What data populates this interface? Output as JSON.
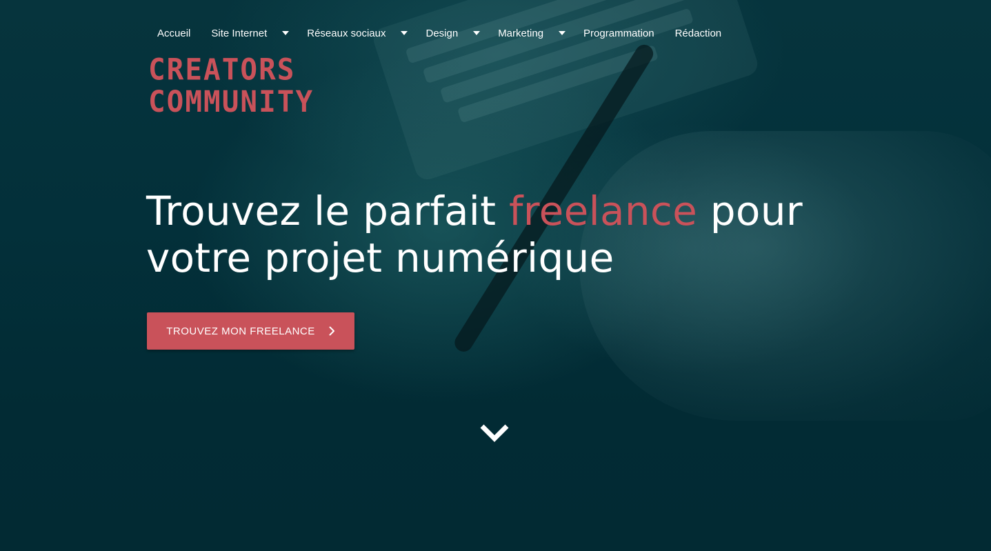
{
  "nav": {
    "items": [
      {
        "label": "Accueil",
        "dropdown": false
      },
      {
        "label": "Site Internet",
        "dropdown": true
      },
      {
        "label": "Réseaux sociaux",
        "dropdown": true
      },
      {
        "label": "Design",
        "dropdown": true
      },
      {
        "label": "Marketing",
        "dropdown": true
      },
      {
        "label": "Programmation",
        "dropdown": false
      },
      {
        "label": "Rédaction",
        "dropdown": false
      }
    ]
  },
  "logo": {
    "line1": "CREATORS",
    "line2": "COMMUNITY"
  },
  "hero": {
    "headline_part1": "Trouvez le parfait ",
    "headline_accent": "freelance",
    "headline_part2": " pour votre projet numérique",
    "cta_label": "TROUVEZ MON FREELANCE",
    "cta_icon": "chevron-right-icon",
    "scroll_icon": "chevron-down-icon"
  },
  "colors": {
    "accent": "#c9525a",
    "background": "#042a33",
    "text": "#ffffff"
  }
}
